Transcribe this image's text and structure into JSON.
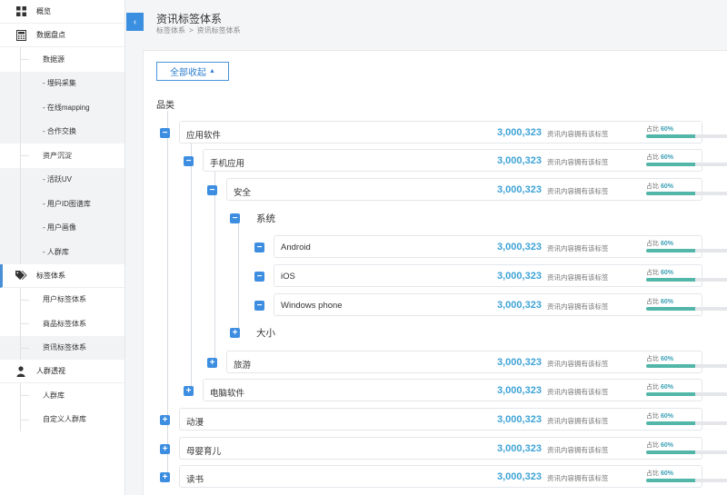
{
  "sidebar": {
    "overview": "概览",
    "data_inventory": "数据盘点",
    "data_source": "数据源",
    "code_collect": "- 埋码采集",
    "online_mapping": "- 在线mapping",
    "cooperation": "- 合作交换",
    "asset_precipitation": "资产沉淀",
    "active_uv": "- 活跃UV",
    "user_id_graph": "- 用户ID图谱库",
    "user_portrait": "- 用户画像",
    "crowd_lib_sub": "- 人群库",
    "tag_system": "标签体系",
    "user_tag": "用户标签体系",
    "product_tag": "商品标签体系",
    "info_tag": "资讯标签体系",
    "crowd_insight": "人群透视",
    "crowd_lib": "人群库",
    "custom_crowd": "自定义人群库"
  },
  "header": {
    "title": "资讯标签体系",
    "breadcrumb": [
      "标签体系",
      "资讯标签体系"
    ],
    "breadcrumb_sep": ">"
  },
  "toolbar": {
    "collapse_all": "全部收起"
  },
  "category_label": "品类",
  "icons": {
    "toggle_expanded": "−",
    "toggle_collapsed": "+",
    "back": "‹"
  },
  "common": {
    "count": "3,000,323",
    "count_label": "资讯内容拥有该标签",
    "pct_prefix": "占比",
    "pct_value": "60%",
    "pct_fraction": 0.6
  },
  "rows": [
    {
      "name": "应用软件"
    },
    {
      "name": "手机应用"
    },
    {
      "name": "安全"
    },
    {
      "name": "系统"
    },
    {
      "name": "Android"
    },
    {
      "name": "iOS"
    },
    {
      "name": "Windows phone"
    },
    {
      "name": "大小"
    },
    {
      "name": "旅游"
    },
    {
      "name": "电脑软件"
    },
    {
      "name": "动漫"
    },
    {
      "name": "母婴育儿"
    },
    {
      "name": "读书"
    }
  ],
  "colors": {
    "accent": "#3d8ee0",
    "count": "#3ea3d6",
    "bar_fill": "#52b6a8"
  }
}
